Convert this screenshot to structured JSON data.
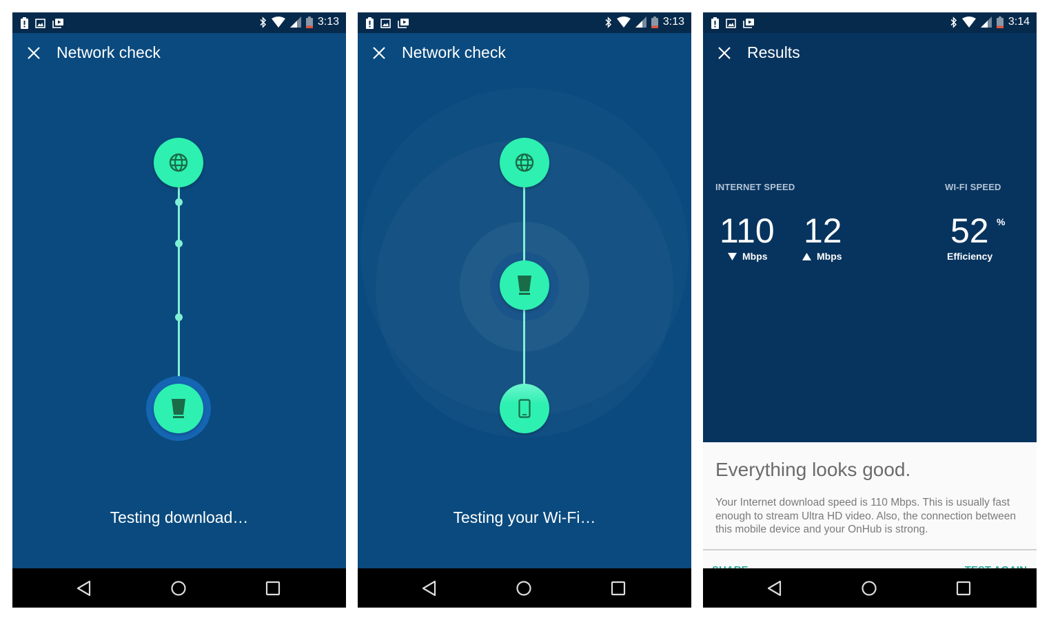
{
  "colors": {
    "statusbar_bg": "#062a4c",
    "screen_bg": "#0a4a7e",
    "results_bg": "#07345e",
    "node_fill": "#2ef0b0",
    "node_icon": "#1a6b48",
    "chain_line": "#7ff0d6",
    "accent_action": "#2aa89a"
  },
  "screens": [
    {
      "statusbar": {
        "left_icons": [
          "battery-alert-icon",
          "image-icon",
          "media-play-icon"
        ],
        "right_icons": [
          "bluetooth-icon",
          "wifi-icon",
          "cell-signal-icon",
          "battery-low-icon"
        ],
        "time": "3:13"
      },
      "appbar": {
        "close_icon": "close-icon",
        "title": "Network check"
      },
      "chain": {
        "nodes": [
          {
            "name": "internet",
            "icon": "globe-icon",
            "active": false
          },
          {
            "name": "onhub-router",
            "icon": "router-icon",
            "active": true
          }
        ],
        "intermediate_dots": 3
      },
      "status_text": "Testing download…",
      "navbar": {
        "back": "back-icon",
        "home": "home-icon",
        "recents": "recents-icon"
      }
    },
    {
      "statusbar": {
        "left_icons": [
          "battery-alert-icon",
          "image-icon",
          "media-play-icon"
        ],
        "right_icons": [
          "bluetooth-icon",
          "wifi-icon",
          "cell-signal-icon",
          "battery-low-icon"
        ],
        "time": "3:13"
      },
      "appbar": {
        "close_icon": "close-icon",
        "title": "Network check"
      },
      "chain": {
        "nodes": [
          {
            "name": "internet",
            "icon": "globe-icon",
            "active": false
          },
          {
            "name": "onhub-router",
            "icon": "router-icon",
            "active": true
          },
          {
            "name": "mobile-device",
            "icon": "phone-icon",
            "active": false
          }
        ]
      },
      "status_text": "Testing your Wi-Fi…",
      "navbar": {
        "back": "back-icon",
        "home": "home-icon",
        "recents": "recents-icon"
      }
    },
    {
      "statusbar": {
        "left_icons": [
          "battery-alert-icon",
          "image-icon",
          "media-play-icon"
        ],
        "right_icons": [
          "bluetooth-icon",
          "wifi-icon",
          "cell-signal-icon",
          "battery-low-icon"
        ],
        "time": "3:14"
      },
      "appbar": {
        "close_icon": "close-icon",
        "title": "Results"
      },
      "results": {
        "internet_speed": {
          "label": "INTERNET SPEED",
          "download": {
            "value": "110",
            "unit": "Mbps",
            "direction": "down"
          },
          "upload": {
            "value": "12",
            "unit": "Mbps",
            "direction": "up"
          }
        },
        "wifi_speed": {
          "label": "WI-FI SPEED",
          "value": "52",
          "suffix": "%",
          "unit": "Efficiency"
        }
      },
      "card": {
        "title": "Everything looks good.",
        "body": "Your Internet download speed is 110 Mbps. This is usually fast enough to stream Ultra HD video. Also, the connection between this mobile device and your OnHub is strong.",
        "actions": {
          "share": "SHARE",
          "test_again": "TEST AGAIN"
        }
      },
      "navbar": {
        "back": "back-icon",
        "home": "home-icon",
        "recents": "recents-icon"
      }
    }
  ]
}
